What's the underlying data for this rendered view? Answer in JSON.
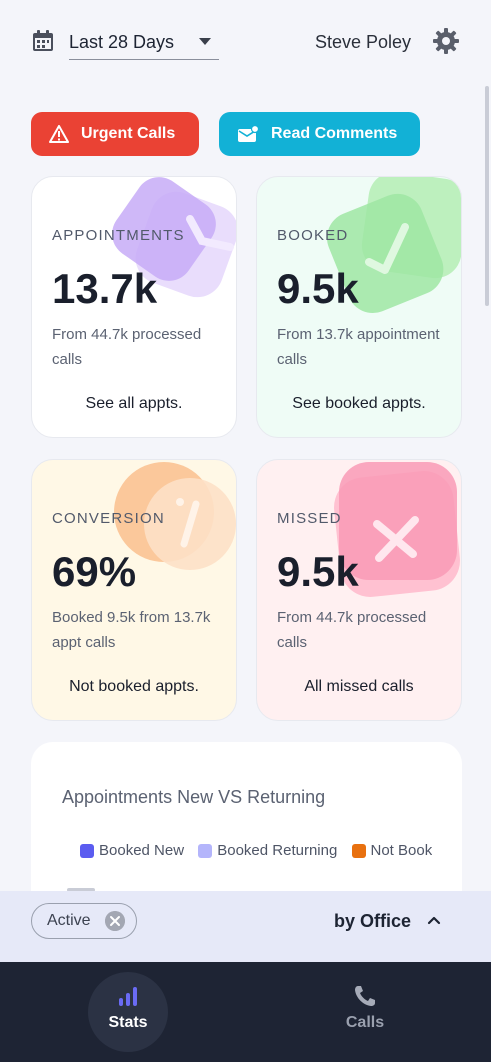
{
  "header": {
    "date_range": "Last 28 Days",
    "user_name": "Steve Poley"
  },
  "actions": {
    "urgent_label": "Urgent Calls",
    "comments_label": "Read Comments"
  },
  "cards": [
    {
      "label": "APPOINTMENTS",
      "value": "13.7k",
      "sub": "From 44.7k processed calls",
      "link": "See all appts."
    },
    {
      "label": "BOOKED",
      "value": "9.5k",
      "sub": "From 13.7k appointment calls",
      "link": "See booked appts."
    },
    {
      "label": "CONVERSION",
      "value": "69%",
      "sub": "Booked 9.5k from 13.7k appt calls",
      "link": "Not booked appts."
    },
    {
      "label": "MISSED",
      "value": "9.5k",
      "sub": "From 44.7k processed calls",
      "link": "All missed calls"
    }
  ],
  "chart": {
    "title": "Appointments New VS Returning",
    "legend": [
      {
        "name": "Booked New",
        "color": "#5b5cf0"
      },
      {
        "name": "Booked Returning",
        "color": "#b4b5fb"
      },
      {
        "name": "Not Booked",
        "color": "#e8700f"
      }
    ]
  },
  "filter": {
    "chip_label": "Active",
    "group_by": "by Office"
  },
  "nav": {
    "stats_label": "Stats",
    "calls_label": "Calls"
  },
  "colors": {
    "urgent": "#ea4234",
    "comments": "#12b1d6",
    "nav_bg": "#1e2434",
    "accent": "#5b5cf0"
  }
}
